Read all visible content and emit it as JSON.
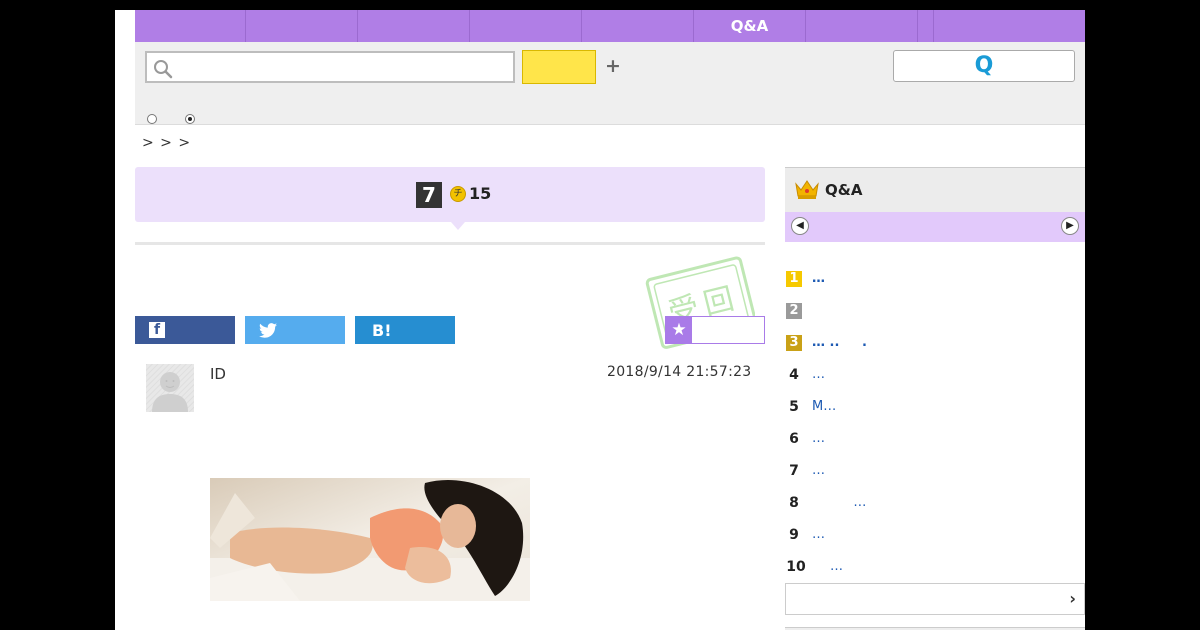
{
  "nav": {
    "tabs": [
      "",
      "",
      "",
      "",
      "",
      "Q&A",
      "",
      "",
      ""
    ]
  },
  "search": {
    "placeholder": "",
    "button_label": "",
    "plus_label": "+",
    "qa_button_label": "Q"
  },
  "breadcrumb": "> > >",
  "question": {
    "answer_count": "7",
    "coin_label": "チ",
    "points": "15",
    "stamp_chars": [
      "受",
      "回"
    ]
  },
  "share": {
    "facebook_label": "f",
    "twitter_label": "",
    "hatena_label": "B!",
    "favorite_star": "★"
  },
  "post": {
    "user_id": "ID",
    "timestamp": "2018/9/14  21:57:23"
  },
  "sidebar": {
    "title": "Q&A",
    "prev_arrow": "◀",
    "next_arrow": "▶",
    "ranking": [
      {
        "rank": "1",
        "text": "…"
      },
      {
        "rank": "2",
        "text": ""
      },
      {
        "rank": "3",
        "text": "… ..     ."
      },
      {
        "rank": "4",
        "text": "…"
      },
      {
        "rank": "5",
        "text": "M…"
      },
      {
        "rank": "6",
        "text": "…"
      },
      {
        "rank": "7",
        "text": "…"
      },
      {
        "rank": "8",
        "text": "          …"
      },
      {
        "rank": "9",
        "text": "…"
      },
      {
        "rank": "10",
        "text": "…"
      }
    ],
    "more_arrow": "›"
  },
  "colors": {
    "nav_purple": "#b07ee6",
    "header_lavender": "#ece0fb",
    "search_yellow": "#ffe54a",
    "link_blue": "#1d5ab3"
  }
}
